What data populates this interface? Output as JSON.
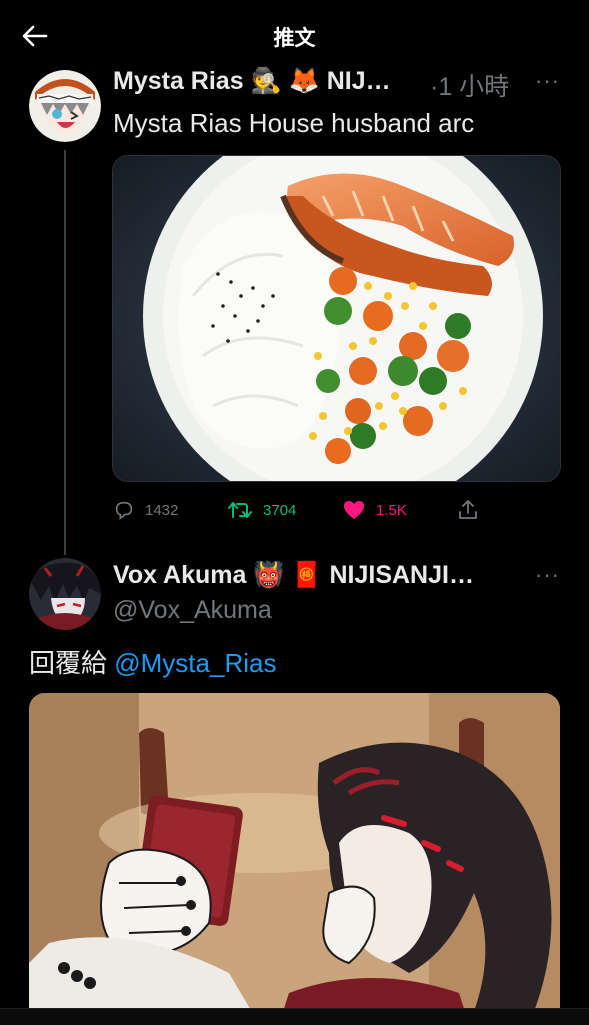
{
  "header": {
    "title": "推文",
    "back_icon": "arrow-left-icon"
  },
  "tweet": {
    "author_name": "Mysta Rias 🕵️ 🦊 NIJ…",
    "time_text": "·1 小時",
    "more_label": "···",
    "text": "Mysta Rias House husband arc",
    "media_alt": "",
    "stats": {
      "replies": "1432",
      "retweets": "3704",
      "likes": "1.5K"
    },
    "colors": {
      "retweet": "#00ba7c",
      "like": "#f91880",
      "muted": "#71767b"
    }
  },
  "reply": {
    "author_name": "Vox Akuma 👹 🧧 NIJISANJI…",
    "handle": "@Vox_Akuma",
    "more_label": "···",
    "reply_prefix": "回覆給",
    "reply_mention": "@Mysta_Rias",
    "colors": {
      "mention": "#1d9bf0"
    }
  }
}
